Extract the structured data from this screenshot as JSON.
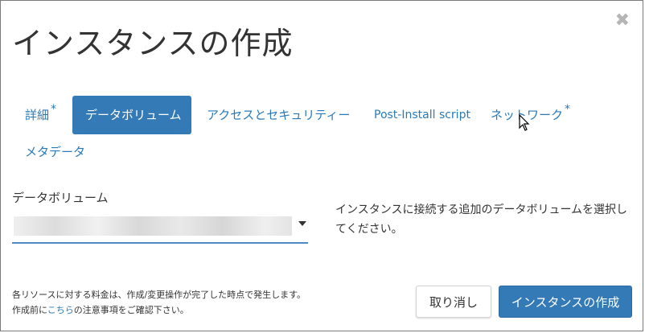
{
  "dialog": {
    "title": "インスタンスの作成",
    "close_icon": "close-icon"
  },
  "tabs": [
    {
      "label": "詳細",
      "required": true,
      "active": false
    },
    {
      "label": "データボリューム",
      "required": false,
      "active": true
    },
    {
      "label": "アクセスとセキュリティー",
      "required": false,
      "active": false
    },
    {
      "label": "Post-Install script",
      "required": false,
      "active": false
    },
    {
      "label": "ネットワーク",
      "required": true,
      "active": false
    },
    {
      "label": "メタデータ",
      "required": false,
      "active": false
    }
  ],
  "required_marker": "*",
  "form": {
    "volume_label": "データボリューム",
    "help_text": "インスタンスに接続する追加のデータボリュームを選択してください。"
  },
  "footer": {
    "note_line1": "各リソースに対する料金は、作成/変更操作が完了した時点で発生します。",
    "note_prefix": "作成前に",
    "note_link": "こちら",
    "note_suffix": "の注意事項をご確認下さい。",
    "cancel_label": "取り消し",
    "create_label": "インスタンスの作成"
  },
  "colors": {
    "accent": "#337ab7",
    "link": "#2a7ab8"
  }
}
